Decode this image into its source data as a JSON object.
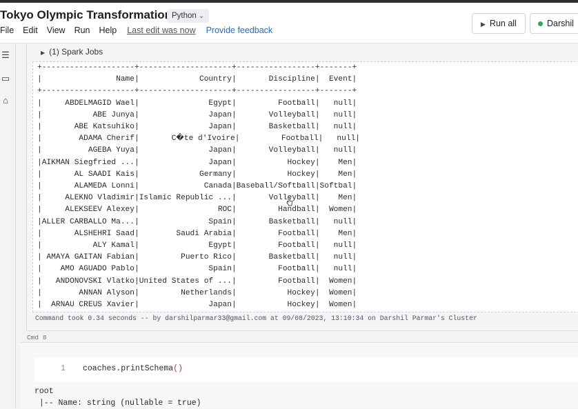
{
  "header": {
    "title": "Tokyo Olympic Transformation",
    "language": "Python",
    "menu": [
      "File",
      "Edit",
      "View",
      "Run",
      "Help"
    ],
    "last_edit": "Last edit was now",
    "feedback": "Provide feedback",
    "run_all": "Run all",
    "cluster_label": "Darshil"
  },
  "cell1": {
    "spark_jobs": "(1) Spark Jobs",
    "table_border": "+--------------------+--------------------+-----------------+-------+",
    "columns": [
      "Name",
      "Country",
      "Discipline",
      "Event"
    ],
    "rows": [
      [
        "ABDELMAGID Wael",
        "Egypt",
        "Football",
        "null"
      ],
      [
        "ABE Junya",
        "Japan",
        "Volleyball",
        "null"
      ],
      [
        "ABE Katsuhiko",
        "Japan",
        "Basketball",
        "null"
      ],
      [
        "ADAMA Cherif",
        "C�te d'Ivoire",
        "Football",
        "null"
      ],
      [
        "AGEBA Yuya",
        "Japan",
        "Volleyball",
        "null"
      ],
      [
        "AIKMAN Siegfried ...",
        "Japan",
        "Hockey",
        "Men"
      ],
      [
        "AL SAADI Kais",
        "Germany",
        "Hockey",
        "Men"
      ],
      [
        "ALAMEDA Lonni",
        "Canada",
        "Baseball/Softball",
        "Softball"
      ],
      [
        "ALEKNO Vladimir",
        "Islamic Republic ...",
        "Volleyball",
        "Men"
      ],
      [
        "ALEKSEEV Alexey",
        "ROC",
        "Handball",
        "Women"
      ],
      [
        "ALLER CARBALLO Ma...",
        "Spain",
        "Basketball",
        "null"
      ],
      [
        "ALSHEHRI Saad",
        "Saudi Arabia",
        "Football",
        "Men"
      ],
      [
        "ALY Kamal",
        "Egypt",
        "Football",
        "null"
      ],
      [
        "AMAYA GAITAN Fabian",
        "Puerto Rico",
        "Basketball",
        "null"
      ],
      [
        "AMO AGUADO Pablo",
        "Spain",
        "Football",
        "null"
      ],
      [
        "ANDONOVSKI Vlatko",
        "United States of ...",
        "Football",
        "Women"
      ],
      [
        "ANNAN Alyson",
        "Netherlands",
        "Hockey",
        "Women"
      ],
      [
        "ARNAU CREUS Xavier",
        "Japan",
        "Hockey",
        "Women"
      ]
    ],
    "command_took": "Command took 0.34 seconds -- by darshilparmar33@gmail.com at 09/08/2023, 13:10:34 on Darshil Parmar's Cluster"
  },
  "cmd_label": "Cmd 8",
  "cell2": {
    "line_number": "1",
    "code_fn": "coaches.printSchema",
    "code_paren": "()",
    "output_root": "root",
    "output_line": " |-- Name: string (nullable = true)"
  }
}
